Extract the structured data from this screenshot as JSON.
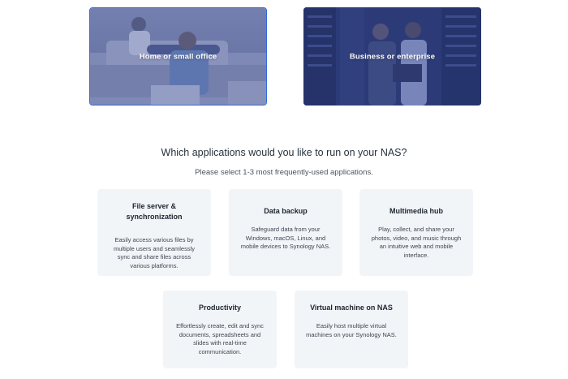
{
  "environments": [
    {
      "label": "Home or small office",
      "selected": true
    },
    {
      "label": "Business or enterprise",
      "selected": false
    }
  ],
  "question": "Which applications would you like to run on your NAS?",
  "subtext": "Please select 1-3 most frequently-used applications.",
  "applications": [
    {
      "title": "File server & synchronization",
      "description": "Easily access various files by multiple users and seamlessly sync and share files across various platforms."
    },
    {
      "title": "Data backup",
      "description": "Safeguard data from your Windows, macOS, Linux, and mobile devices to Synology NAS."
    },
    {
      "title": "Multimedia hub",
      "description": "Play, collect, and share your photos, video, and music through an intuitive web and mobile interface."
    },
    {
      "title": "Productivity",
      "description": "Effortlessly create, edit and sync documents, spreadsheets and slides with real-time communication."
    },
    {
      "title": "Virtual machine on NAS",
      "description": "Easily host multiple virtual machines on your Synology NAS."
    }
  ],
  "colors": {
    "selected_border": "#2f6ce0",
    "card_bg": "#f2f5f8",
    "overlay": "#3a4f9a"
  }
}
